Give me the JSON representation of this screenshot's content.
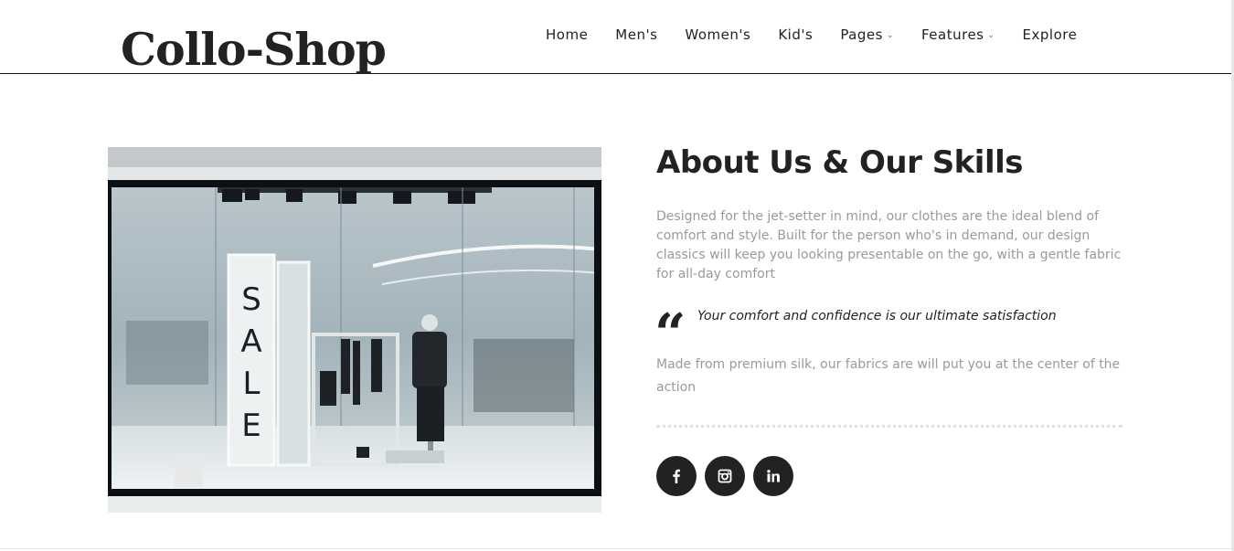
{
  "brand": {
    "logo_text": "Collo-Shop"
  },
  "nav": {
    "items": [
      {
        "label": "Home",
        "has_dropdown": false
      },
      {
        "label": "Men's",
        "has_dropdown": false
      },
      {
        "label": "Women's",
        "has_dropdown": false
      },
      {
        "label": "Kid's",
        "has_dropdown": false
      },
      {
        "label": "Pages",
        "has_dropdown": true
      },
      {
        "label": "Features",
        "has_dropdown": true
      },
      {
        "label": "Explore",
        "has_dropdown": false
      }
    ],
    "dropdown_icon": "chevron-down-icon"
  },
  "about": {
    "title": "About Us & Our Skills",
    "description": "Designed for the jet-setter in mind, our clothes are the ideal blend of comfort and style. Built for the person who's in demand, our design classics will keep you looking presentable on the go, with a gentle fabric for all-day comfort",
    "quote": "Your comfort and confidence is our ultimate satisfaction",
    "quote_icon": "quote-icon",
    "detail": "Made from premium silk, our fabrics are will put you at the center of the action"
  },
  "store_image": {
    "sign_letters": [
      "S",
      "A",
      "L",
      "E"
    ]
  },
  "socials": [
    {
      "name": "facebook",
      "icon": "facebook-icon"
    },
    {
      "name": "instagram",
      "icon": "instagram-icon"
    },
    {
      "name": "linkedin",
      "icon": "linkedin-icon"
    }
  ],
  "colors": {
    "text_dark": "#222222",
    "text_muted": "#9a9a9a",
    "social_bg": "#222222"
  }
}
